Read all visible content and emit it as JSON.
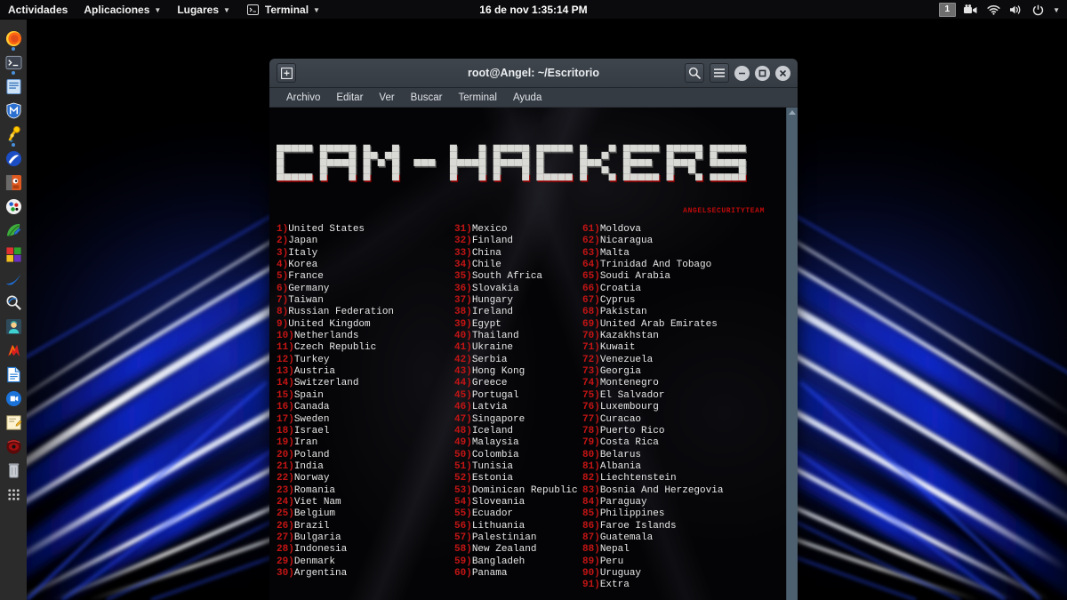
{
  "topbar": {
    "activities": "Actividades",
    "applications": "Aplicaciones",
    "places": "Lugares",
    "app_name": "Terminal",
    "clock": "16 de nov  1:35:14 PM",
    "workspace": "1",
    "icons": [
      "terminal-menu-icon",
      "screencast-icon",
      "wifi-icon",
      "volume-icon",
      "power-icon",
      "chevron-down-icon"
    ]
  },
  "dock": {
    "items": [
      {
        "name": "firefox",
        "running": true
      },
      {
        "name": "terminal",
        "running": true
      },
      {
        "name": "text-editor",
        "running": false
      },
      {
        "name": "metasploit",
        "running": false
      },
      {
        "name": "burpsuite",
        "running": true
      },
      {
        "name": "ettercap",
        "running": false
      },
      {
        "name": "gimp",
        "running": false
      },
      {
        "name": "hydra",
        "running": false
      },
      {
        "name": "leafpad",
        "running": false
      },
      {
        "name": "windows-apps",
        "running": false
      },
      {
        "name": "wireshark",
        "running": false
      },
      {
        "name": "nmap-zenmap",
        "running": false
      },
      {
        "name": "aircrack",
        "running": false
      },
      {
        "name": "johntheripper",
        "running": false
      },
      {
        "name": "libreoffice-writer",
        "running": false
      },
      {
        "name": "video-player",
        "running": false
      },
      {
        "name": "notes",
        "running": false
      },
      {
        "name": "beef",
        "running": false
      },
      {
        "name": "trash",
        "running": false
      },
      {
        "name": "show-applications",
        "running": false
      }
    ]
  },
  "terminal": {
    "title": "root@Angel: ~/Escritorio",
    "titlebar_buttons": [
      "new-tab-icon",
      "search-icon",
      "hamburger-menu-icon",
      "minimize-button",
      "maximize-button",
      "close-button"
    ],
    "menu": [
      "Archivo",
      "Editar",
      "Ver",
      "Buscar",
      "Terminal",
      "Ayuda"
    ],
    "banner_ascii": "  ▄████▄   ▄▄▄       ███▄ ▄███▓    ██░ ██  ▄▄▄       ▄████▄   ██ ▄█▀▓█████  ██▀███    ██████\n ▒██▀ ▀█  ▒████▄    ▓██▒▀█▀ ██▒   ▓██░ ██▒▒████▄    ▒██▀ ▀█   ██▄█▒ ▓█   ▀ ▓██ ▒ ██▒▒██    ▒\n ▒▓█    ▄ ▒██  ▀█▄  ▓██    ▓██░   ▒██▀▀██░▒██  ▀█▄  ▒▓█    ▄ ▓███▄░ ▒███   ▓██ ░▄█ ▒░ ▓██▄\n ▒▓▓▄ ▄██▒░██▄▄▄▄██ ▒██    ▒██    ░▓█ ░██ ░██▄▄▄▄██ ▒▓▓▄ ▄██▒▓██ █▄ ▒▓█  ▄ ▒██▀▀█▄    ▒   ██▒\n ▒ ▓███▀ ░ ▓█   ▓██▒▒██▒   ░██▒   ░▓█▒░██▓ ▓█   ▓██▒▒ ▓███▀ ░▒██▒ █▄░▒████▒░██▓ ▒██▒▒██████▒▒\n ░ ░▒ ▒  ░ ▒▒   ▓▒█░░ ▒░   ░  ░    ▒ ░░▒░▒ ▒▒   ▓▒█░░ ░▒ ▒  ░▒ ▒▒ ▓▒░░ ▒░ ░░ ▒▓ ░▒▓░▒ ▒▓▒ ▒ ░",
    "banner_text": "CAM-HACKERS",
    "banner_credit": "ANGELSECURITYTEAM",
    "scrollbar": "vertical-scrollbar",
    "columns": [
      [
        {
          "n": "1",
          "c": "United States"
        },
        {
          "n": "2",
          "c": "Japan"
        },
        {
          "n": "3",
          "c": "Italy"
        },
        {
          "n": "4",
          "c": "Korea"
        },
        {
          "n": "5",
          "c": "France"
        },
        {
          "n": "6",
          "c": "Germany"
        },
        {
          "n": "7",
          "c": "Taiwan"
        },
        {
          "n": "8",
          "c": "Russian Federation"
        },
        {
          "n": "9",
          "c": "United Kingdom"
        },
        {
          "n": "10",
          "c": "Netherlands"
        },
        {
          "n": "11",
          "c": "Czech Republic"
        },
        {
          "n": "12",
          "c": "Turkey"
        },
        {
          "n": "13",
          "c": "Austria"
        },
        {
          "n": "14",
          "c": "Switzerland"
        },
        {
          "n": "15",
          "c": "Spain"
        },
        {
          "n": "16",
          "c": "Canada"
        },
        {
          "n": "17",
          "c": "Sweden"
        },
        {
          "n": "18",
          "c": "Israel"
        },
        {
          "n": "19",
          "c": "Iran"
        },
        {
          "n": "20",
          "c": "Poland"
        },
        {
          "n": "21",
          "c": "India"
        },
        {
          "n": "22",
          "c": "Norway"
        },
        {
          "n": "23",
          "c": "Romania"
        },
        {
          "n": "24",
          "c": "Viet Nam"
        },
        {
          "n": "25",
          "c": "Belgium"
        },
        {
          "n": "26",
          "c": "Brazil"
        },
        {
          "n": "27",
          "c": "Bulgaria"
        },
        {
          "n": "28",
          "c": "Indonesia"
        },
        {
          "n": "29",
          "c": "Denmark"
        },
        {
          "n": "30",
          "c": "Argentina"
        }
      ],
      [
        {
          "n": "31",
          "c": "Mexico"
        },
        {
          "n": "32",
          "c": "Finland"
        },
        {
          "n": "33",
          "c": "China"
        },
        {
          "n": "34",
          "c": "Chile"
        },
        {
          "n": "35",
          "c": "South Africa"
        },
        {
          "n": "36",
          "c": "Slovakia"
        },
        {
          "n": "37",
          "c": "Hungary"
        },
        {
          "n": "38",
          "c": "Ireland"
        },
        {
          "n": "39",
          "c": "Egypt"
        },
        {
          "n": "40",
          "c": "Thailand"
        },
        {
          "n": "41",
          "c": "Ukraine"
        },
        {
          "n": "42",
          "c": "Serbia"
        },
        {
          "n": "43",
          "c": "Hong Kong"
        },
        {
          "n": "44",
          "c": "Greece"
        },
        {
          "n": "45",
          "c": "Portugal"
        },
        {
          "n": "46",
          "c": "Latvia"
        },
        {
          "n": "47",
          "c": "Singapore"
        },
        {
          "n": "48",
          "c": "Iceland"
        },
        {
          "n": "49",
          "c": "Malaysia"
        },
        {
          "n": "50",
          "c": "Colombia"
        },
        {
          "n": "51",
          "c": "Tunisia"
        },
        {
          "n": "52",
          "c": "Estonia"
        },
        {
          "n": "53",
          "c": "Dominican Republic"
        },
        {
          "n": "54",
          "c": "Sloveania"
        },
        {
          "n": "55",
          "c": "Ecuador"
        },
        {
          "n": "56",
          "c": "Lithuania"
        },
        {
          "n": "57",
          "c": "Palestinian"
        },
        {
          "n": "58",
          "c": "New Zealand"
        },
        {
          "n": "59",
          "c": "Bangladeh"
        },
        {
          "n": "60",
          "c": "Panama"
        }
      ],
      [
        {
          "n": "61",
          "c": "Moldova"
        },
        {
          "n": "62",
          "c": "Nicaragua"
        },
        {
          "n": "63",
          "c": "Malta"
        },
        {
          "n": "64",
          "c": "Trinidad And Tobago"
        },
        {
          "n": "65",
          "c": "Soudi Arabia"
        },
        {
          "n": "66",
          "c": "Croatia"
        },
        {
          "n": "67",
          "c": "Cyprus"
        },
        {
          "n": "68",
          "c": "Pakistan"
        },
        {
          "n": "69",
          "c": "United Arab Emirates"
        },
        {
          "n": "70",
          "c": "Kazakhstan"
        },
        {
          "n": "71",
          "c": "Kuwait"
        },
        {
          "n": "72",
          "c": "Venezuela"
        },
        {
          "n": "73",
          "c": "Georgia"
        },
        {
          "n": "74",
          "c": "Montenegro"
        },
        {
          "n": "75",
          "c": "El Salvador"
        },
        {
          "n": "76",
          "c": "Luxembourg"
        },
        {
          "n": "77",
          "c": "Curacao"
        },
        {
          "n": "78",
          "c": "Puerto Rico"
        },
        {
          "n": "79",
          "c": "Costa Rica"
        },
        {
          "n": "80",
          "c": "Belarus"
        },
        {
          "n": "81",
          "c": "Albania"
        },
        {
          "n": "82",
          "c": "Liechtenstein"
        },
        {
          "n": "83",
          "c": "Bosnia And Herzegovia"
        },
        {
          "n": "84",
          "c": "Paraguay"
        },
        {
          "n": "85",
          "c": "Philippines"
        },
        {
          "n": "86",
          "c": "Faroe Islands"
        },
        {
          "n": "87",
          "c": "Guatemala"
        },
        {
          "n": "88",
          "c": "Nepal"
        },
        {
          "n": "89",
          "c": "Peru"
        },
        {
          "n": "90",
          "c": "Uruguay"
        },
        {
          "n": "91",
          "c": "Extra"
        }
      ]
    ]
  },
  "colors": {
    "number_red": "#c41414",
    "country_white": "#e8e8e8",
    "credit_red": "#c00a0a",
    "topbar_bg": "#0b0b0d",
    "titlebar_bg": "#3b4149",
    "dock_bg": "#2b2b2b",
    "accent_blue": "#4a90d9"
  }
}
